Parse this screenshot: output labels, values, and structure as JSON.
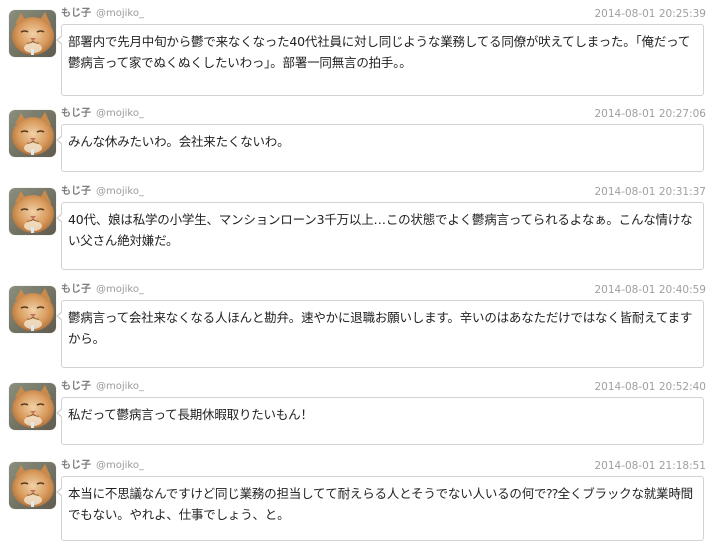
{
  "tweets": [
    {
      "name": "もじ子",
      "handle": "@mojiko_",
      "time": "2014-08-01 20:25:39",
      "text": "部署内で先月中旬から鬱で来なくなった40代社員に対し同じような業務してる同僚が吠えてしまった。「俺だって鬱病言って家でぬくぬくしたいわっ」。部署一同無言の拍手。。"
    },
    {
      "name": "もじ子",
      "handle": "@mojiko_",
      "time": "2014-08-01 20:27:06",
      "text": "みんな休みたいわ。会社来たくないわ。"
    },
    {
      "name": "もじ子",
      "handle": "@mojiko_",
      "time": "2014-08-01 20:31:37",
      "text": "40代、娘は私学の小学生、マンションローン3千万以上…この状態でよく鬱病言ってられるよなぁ。こんな情けない父さん絶対嫌だ。"
    },
    {
      "name": "もじ子",
      "handle": "@mojiko_",
      "time": "2014-08-01 20:40:59",
      "text": "鬱病言って会社来なくなる人ほんと勘弁。速やかに退職お願いします。辛いのはあなただけではなく皆耐えてますから。"
    },
    {
      "name": "もじ子",
      "handle": "@mojiko_",
      "time": "2014-08-01 20:52:40",
      "text": "私だって鬱病言って長期休暇取りたいもん！"
    },
    {
      "name": "もじ子",
      "handle": "@mojiko_",
      "time": "2014-08-01 21:18:51",
      "text": "本当に不思議なんですけど同じ業務の担当してて耐えらる人とそうでない人いるの何で⁇全くブラックな就業時間でもない。やれよ、仕事でしょう、と。"
    }
  ],
  "colors": {
    "bubble_border": "#d2d2d2",
    "name": "#7d7d7d",
    "timestamp": "#a0a0a0",
    "text": "#222222"
  },
  "avatar_icon": "cat-photo"
}
